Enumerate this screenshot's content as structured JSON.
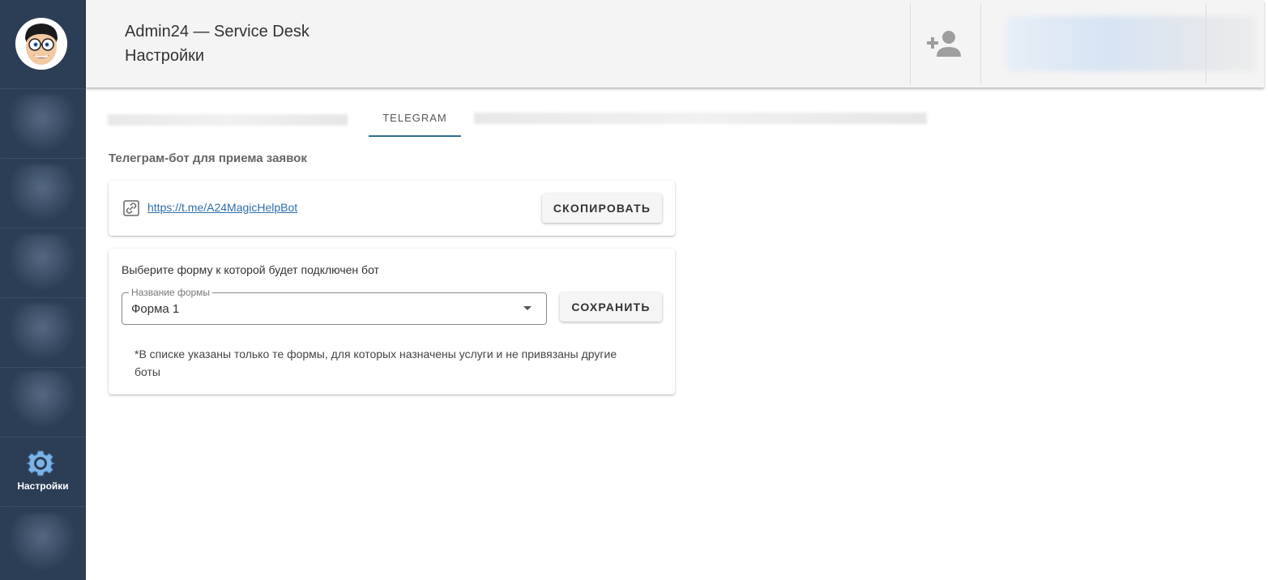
{
  "header": {
    "app_title": "Admin24 — Service Desk",
    "page_title": "Настройки",
    "add_user_icon": "person-add-icon"
  },
  "sidebar": {
    "avatar_icon": "cartoon-avatar",
    "active_item": {
      "label": "Настройки",
      "icon": "gear-icon"
    }
  },
  "tabs": [
    {
      "label": "TELEGRAM",
      "active": true
    }
  ],
  "section": {
    "title": "Телеграм-бот для приема заявок"
  },
  "bot_card": {
    "link_icon": "link-icon",
    "link": "https://t.me/A24MagicHelpBot",
    "copy_label": "СКОПИРОВАТЬ"
  },
  "form_card": {
    "hint": "Выберите форму к которой будет подключен бот",
    "select_label": "Название формы",
    "select_value": "Форма 1",
    "save_label": "СОХРАНИТЬ",
    "note": "*В списке указаны только те формы, для которых назначены услуги и не привязаны другие боты"
  },
  "colors": {
    "sidebar": "#2c3e55",
    "accent": "#2f6f8f",
    "link": "#2f6fa8",
    "header_bg": "#f4f4f4"
  }
}
